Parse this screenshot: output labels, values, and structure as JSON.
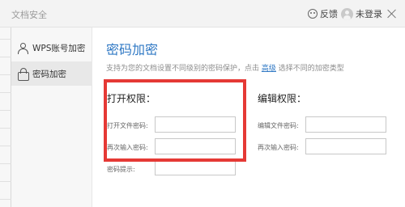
{
  "window": {
    "title": "文档安全",
    "feedback_label": "反馈",
    "login_label": "未登录"
  },
  "sidebar": {
    "items": [
      {
        "label": "WPS账号加密",
        "icon": "user-icon",
        "active": false
      },
      {
        "label": "密码加密",
        "icon": "lock-icon",
        "active": true
      }
    ]
  },
  "main": {
    "heading": "密码加密",
    "description_before": "支持为您的文档设置不同级别的密码保护，点击",
    "advanced_link": "高级",
    "description_after": "选择不同的加密类型",
    "open_section": {
      "title": "打开权限：",
      "password_label": "打开文件密码:",
      "password_value": "",
      "confirm_label": "再次输入密码:",
      "confirm_value": "",
      "hint_label": "密码提示:",
      "hint_value": ""
    },
    "edit_section": {
      "title": "编辑权限：",
      "password_label": "编辑文件密码:",
      "password_value": "",
      "confirm_label": "再次输入密码:",
      "confirm_value": ""
    }
  },
  "colors": {
    "accent": "#2f78c4",
    "highlight": "#e53935"
  }
}
